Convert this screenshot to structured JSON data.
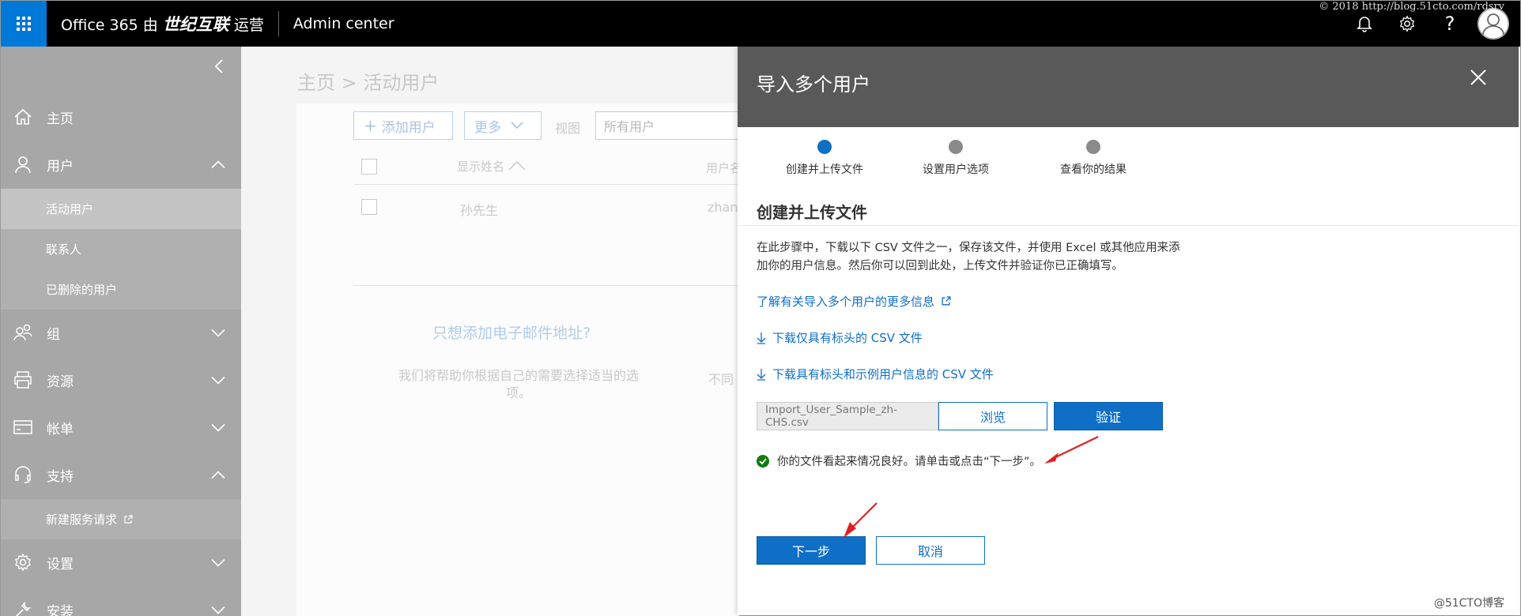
{
  "topbar": {
    "brand_prefix": "Office 365 由",
    "brand_name": "世纪互联",
    "brand_suffix": "运营",
    "app_name": "Admin center",
    "watermark": "© 2018 http://blog.51cto.com/rdsrv"
  },
  "sidebar": {
    "items": [
      {
        "label": "主页",
        "icon": "home-icon"
      },
      {
        "label": "用户",
        "icon": "user-icon"
      },
      {
        "label": "组",
        "icon": "group-icon"
      },
      {
        "label": "资源",
        "icon": "printer-icon"
      },
      {
        "label": "帐单",
        "icon": "card-icon"
      },
      {
        "label": "支持",
        "icon": "headset-icon"
      },
      {
        "label": "设置",
        "icon": "gear-icon"
      },
      {
        "label": "安装",
        "icon": "wrench-icon"
      }
    ],
    "user_subitems": [
      "活动用户",
      "联系人",
      "已删除的用户"
    ],
    "support_subitems": [
      "新建服务请求"
    ]
  },
  "background": {
    "breadcrumb": "主页 > 活动用户",
    "add_user": "添加用户",
    "more": "更多",
    "view_label": "视图",
    "view_value": "所有用户",
    "col_display_name": "显示姓名",
    "col_username": "用户名",
    "row_name": "孙先生",
    "row_username": "zhan",
    "promo_title": "只想添加电子邮件地址?",
    "promo_desc_line1": "我们将帮助你根据自己的需要选择适当的选",
    "promo_desc_line2": "项。",
    "promo_desc_right": "不同"
  },
  "flyout": {
    "title": "导入多个用户",
    "steps": [
      {
        "label": "创建并上传文件",
        "color": "#0f6fc6"
      },
      {
        "label": "设置用户选项",
        "color": "#8a8a8a"
      },
      {
        "label": "查看你的结果",
        "color": "#8a8a8a"
      }
    ],
    "section_title": "创建并上传文件",
    "description_line1": "在此步骤中，下载以下 CSV 文件之一，保存该文件，并使用 Excel 或其他应用来添",
    "description_line2": "加你的用户信息。然后你可以回到此处，上传文件并验证你已正确填写。",
    "learn_more": "了解有关导入多个用户的更多信息",
    "download_headers": "下载仅具有标头的 CSV 文件",
    "download_sample": "下载具有标头和示例用户信息的 CSV 文件",
    "file_name": "Import_User_Sample_zh-CHS.csv",
    "browse": "浏览",
    "verify": "验证",
    "status": "你的文件看起来情况良好。请单击或点击“下一步”。",
    "next": "下一步",
    "cancel": "取消"
  },
  "footer_watermark": "@51CTO博客",
  "colors": {
    "accent": "#0f6fc6",
    "success": "#107c10",
    "annotation": "#e02020"
  }
}
